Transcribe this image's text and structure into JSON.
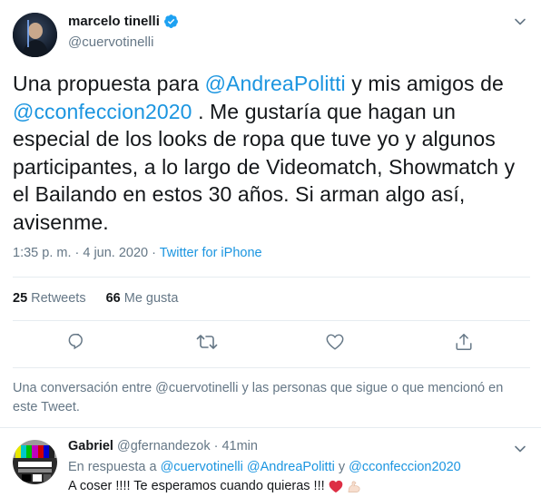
{
  "tweet": {
    "author_name": "marcelo tinelli",
    "author_handle": "@cuervotinelli",
    "text_parts": {
      "p1": "Una propuesta para ",
      "m1": "@AndreaPolitti",
      "p2": " y mis amigos de ",
      "m2": "@cconfeccion2020",
      "p3": " . Me gustaría que hagan un especial de los looks de ropa que tuve yo y algunos participantes, a lo largo de Videomatch, Showmatch y el Bailando en estos 30 años. Si arman algo así, avisenme."
    },
    "time": "1:35 p. m. · 4 jun. 2020 · ",
    "source": "Twitter for iPhone",
    "retweets_count": "25",
    "retweets_label": "Retweets",
    "likes_count": "66",
    "likes_label": "Me gusta"
  },
  "conversation_notice": "Una conversación entre @cuervotinelli y las personas que sigue o que mencionó en este Tweet.",
  "reply": {
    "name": "Gabriel",
    "handle_time": " @gfernandezok · 41min",
    "in_reply_prefix": "En respuesta a ",
    "in_reply_m1": "@cuervotinelli",
    "in_reply_m2": "@AndreaPolitti",
    "in_reply_y": " y ",
    "in_reply_m3": "@cconfeccion2020",
    "text": "A coser !!!! Te esperamos cuando quieras !!!"
  },
  "icons": {
    "verified": "verified-badge-icon",
    "chevron": "chevron-down-icon",
    "reply": "reply-icon",
    "retweet": "retweet-icon",
    "like": "heart-icon",
    "share": "share-icon"
  },
  "colors": {
    "accent": "#1b95e0",
    "muted": "#657786",
    "text": "#14171a",
    "heart_emoji": "#dd2e44"
  }
}
